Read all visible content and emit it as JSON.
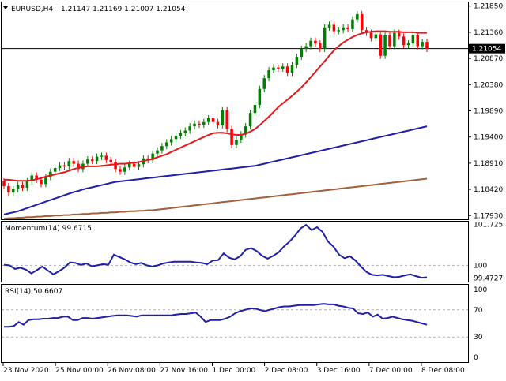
{
  "chart_data": [
    {
      "type": "candlestick",
      "panel": "main",
      "header": {
        "symbol": "EURUSD,H4",
        "ohlc_text": "1.21147 1.21169 1.21007 1.21054"
      },
      "y_ticks": [
        "1.21850",
        "1.21360",
        "1.20870",
        "1.20380",
        "1.19890",
        "1.19400",
        "1.18910",
        "1.18420",
        "1.17930"
      ],
      "y_tick_values": [
        1.2185,
        1.2136,
        1.2087,
        1.2038,
        1.1989,
        1.194,
        1.1891,
        1.1842,
        1.1793
      ],
      "ylim": [
        1.1786,
        1.2192
      ],
      "current_price": "1.21054",
      "current_price_value": 1.21054,
      "bars_open_close": [
        [
          1.1857,
          1.1848
        ],
        [
          1.1848,
          1.1836
        ],
        [
          1.1836,
          1.1842
        ],
        [
          1.1842,
          1.185
        ],
        [
          1.185,
          1.1845
        ],
        [
          1.1845,
          1.1857
        ],
        [
          1.1857,
          1.1868
        ],
        [
          1.1868,
          1.186
        ],
        [
          1.186,
          1.1852
        ],
        [
          1.1852,
          1.1865
        ],
        [
          1.1865,
          1.1875
        ],
        [
          1.1875,
          1.1882
        ],
        [
          1.1882,
          1.1887
        ],
        [
          1.1887,
          1.1885
        ],
        [
          1.1885,
          1.1895
        ],
        [
          1.1895,
          1.189
        ],
        [
          1.189,
          1.188
        ],
        [
          1.188,
          1.189
        ],
        [
          1.189,
          1.1898
        ],
        [
          1.1898,
          1.1895
        ],
        [
          1.1895,
          1.1903
        ],
        [
          1.1903,
          1.1905
        ],
        [
          1.1905,
          1.1897
        ],
        [
          1.1897,
          1.1893
        ],
        [
          1.1893,
          1.188
        ],
        [
          1.188,
          1.1875
        ],
        [
          1.1875,
          1.1883
        ],
        [
          1.1883,
          1.189
        ],
        [
          1.189,
          1.1884
        ],
        [
          1.1884,
          1.1889
        ],
        [
          1.1889,
          1.19
        ],
        [
          1.19,
          1.1897
        ],
        [
          1.1897,
          1.1909
        ],
        [
          1.1909,
          1.1915
        ],
        [
          1.1915,
          1.1923
        ],
        [
          1.1923,
          1.193
        ],
        [
          1.193,
          1.1936
        ],
        [
          1.1936,
          1.1942
        ],
        [
          1.1942,
          1.1947
        ],
        [
          1.1947,
          1.1952
        ],
        [
          1.1952,
          1.196
        ],
        [
          1.196,
          1.1965
        ],
        [
          1.1965,
          1.1963
        ],
        [
          1.1963,
          1.1968
        ],
        [
          1.1968,
          1.1975
        ],
        [
          1.1975,
          1.1968
        ],
        [
          1.1968,
          1.1962
        ],
        [
          1.1962,
          1.199
        ],
        [
          1.199,
          1.1955
        ],
        [
          1.1955,
          1.1925
        ],
        [
          1.1925,
          1.1935
        ],
        [
          1.1935,
          1.1945
        ],
        [
          1.1945,
          1.196
        ],
        [
          1.196,
          1.1985
        ],
        [
          1.1985,
          1.2
        ],
        [
          1.2,
          1.203
        ],
        [
          1.203,
          1.205
        ],
        [
          1.205,
          1.2065
        ],
        [
          1.2065,
          1.207
        ],
        [
          1.207,
          1.2068
        ],
        [
          1.2068,
          1.2072
        ],
        [
          1.2072,
          1.206
        ],
        [
          1.206,
          1.2075
        ],
        [
          1.2075,
          1.209
        ],
        [
          1.209,
          1.2105
        ],
        [
          1.2105,
          1.211
        ],
        [
          1.211,
          1.212
        ],
        [
          1.212,
          1.2115
        ],
        [
          1.2115,
          1.2105
        ],
        [
          1.2105,
          1.2145
        ],
        [
          1.2145,
          1.215
        ],
        [
          1.215,
          1.2138
        ],
        [
          1.2138,
          1.214
        ],
        [
          1.214,
          1.2145
        ],
        [
          1.2145,
          1.2142
        ],
        [
          1.2142,
          1.216
        ],
        [
          1.216,
          1.217
        ],
        [
          1.217,
          1.214
        ],
        [
          1.214,
          1.2135
        ],
        [
          1.2135,
          1.2125
        ],
        [
          1.2125,
          1.2132
        ],
        [
          1.2132,
          1.2092
        ],
        [
          1.2092,
          1.213
        ],
        [
          1.213,
          1.211
        ],
        [
          1.211,
          1.2135
        ],
        [
          1.2135,
          1.2128
        ],
        [
          1.2128,
          1.2112
        ],
        [
          1.2112,
          1.2115
        ],
        [
          1.2115,
          1.213
        ],
        [
          1.213,
          1.211
        ],
        [
          1.211,
          1.2118
        ],
        [
          1.2118,
          1.2105
        ]
      ],
      "sma_red": [
        1.186,
        1.186,
        1.1859,
        1.1858,
        1.1858,
        1.1858,
        1.1859,
        1.1861,
        1.1863,
        1.1866,
        1.1868,
        1.187,
        1.1872,
        1.1874,
        1.1877,
        1.188,
        1.1882,
        1.1884,
        1.1885,
        1.1885,
        1.1885,
        1.1886,
        1.1887,
        1.1888,
        1.1889,
        1.189,
        1.189,
        1.1891,
        1.1892,
        1.1893,
        1.1895,
        1.1897,
        1.1899,
        1.1902,
        1.1905,
        1.1908,
        1.1912,
        1.1916,
        1.192,
        1.1924,
        1.1928,
        1.1932,
        1.1936,
        1.194,
        1.1944,
        1.1947,
        1.1948,
        1.1948,
        1.1947,
        1.1945,
        1.1944,
        1.1944,
        1.1946,
        1.195,
        1.1955,
        1.1962,
        1.197,
        1.1978,
        1.1987,
        1.1996,
        1.2003,
        1.201,
        1.2017,
        1.2025,
        1.2033,
        1.2042,
        1.2052,
        1.2062,
        1.2072,
        1.2082,
        1.2092,
        1.2102,
        1.211,
        1.2117,
        1.2122,
        1.2127,
        1.2131,
        1.2134,
        1.2136,
        1.2137,
        1.2138,
        1.2138,
        1.2138,
        1.2137,
        1.2137,
        1.2137,
        1.2136,
        1.2136,
        1.2136,
        1.2135,
        1.2135,
        1.2135
      ],
      "sma_blue": [
        1.1795,
        1.1797,
        1.1799,
        1.1801,
        1.1804,
        1.1807,
        1.181,
        1.1813,
        1.1816,
        1.1819,
        1.1822,
        1.1825,
        1.1828,
        1.1831,
        1.1834,
        1.1837,
        1.1839,
        1.1842,
        1.1844,
        1.1846,
        1.1848,
        1.185,
        1.1852,
        1.1854,
        1.1856,
        1.1857,
        1.1858,
        1.1859,
        1.186,
        1.1861,
        1.1862,
        1.1863,
        1.1864,
        1.1865,
        1.1866,
        1.1867,
        1.1868,
        1.1869,
        1.187,
        1.1871,
        1.1872,
        1.1873,
        1.1874,
        1.1875,
        1.1876,
        1.1877,
        1.1878,
        1.1879,
        1.188,
        1.1881,
        1.1882,
        1.1883,
        1.1884,
        1.1885,
        1.1886,
        1.1888,
        1.189,
        1.1892,
        1.1894,
        1.1896,
        1.1898,
        1.19,
        1.1902,
        1.1904,
        1.1906,
        1.1908,
        1.191,
        1.1912,
        1.1914,
        1.1916,
        1.1918,
        1.192,
        1.1922,
        1.1924,
        1.1926,
        1.1928,
        1.193,
        1.1932,
        1.1934,
        1.1936,
        1.1938,
        1.194,
        1.1942,
        1.1944,
        1.1946,
        1.1948,
        1.195,
        1.1952,
        1.1954,
        1.1956,
        1.1958,
        1.196
      ],
      "sma_brown": [
        1.1787,
        1.1788,
        1.1788,
        1.1789,
        1.1789,
        1.179,
        1.179,
        1.1791,
        1.1791,
        1.1792,
        1.1792,
        1.1793,
        1.1793,
        1.1794,
        1.1794,
        1.1795,
        1.1795,
        1.1796,
        1.1796,
        1.1797,
        1.1797,
        1.1798,
        1.1798,
        1.1799,
        1.1799,
        1.18,
        1.18,
        1.1801,
        1.1801,
        1.1802,
        1.1802,
        1.1803,
        1.1803,
        1.1804,
        1.1805,
        1.1806,
        1.1807,
        1.1808,
        1.1809,
        1.181,
        1.1811,
        1.1812,
        1.1813,
        1.1814,
        1.1815,
        1.1816,
        1.1817,
        1.1818,
        1.1819,
        1.182,
        1.1821,
        1.1822,
        1.1823,
        1.1824,
        1.1825,
        1.1826,
        1.1827,
        1.1828,
        1.1829,
        1.183,
        1.1831,
        1.1832,
        1.1833,
        1.1834,
        1.1835,
        1.1836,
        1.1837,
        1.1838,
        1.1839,
        1.184,
        1.1841,
        1.1842,
        1.1843,
        1.1844,
        1.1845,
        1.1846,
        1.1847,
        1.1848,
        1.1849,
        1.185,
        1.1851,
        1.1852,
        1.1853,
        1.1854,
        1.1855,
        1.1856,
        1.1857,
        1.1858,
        1.1859,
        1.186,
        1.1861,
        1.1862
      ],
      "colors": {
        "bull": "#008000",
        "bear": "#ff0000",
        "sma_red": "#e31a1c",
        "sma_blue": "#1f1fa8",
        "sma_brown": "#a0603a",
        "price_line": "#000000"
      }
    },
    {
      "type": "line",
      "panel": "momentum",
      "label": "Momentum(14) 99.6715",
      "y_ticks": [
        "101.725",
        "100",
        "99.4727"
      ],
      "y_tick_values": [
        101.725,
        100.0,
        99.4727
      ],
      "ylim": [
        99.35,
        101.8
      ],
      "level": 100,
      "values": [
        100.02,
        100.0,
        99.85,
        99.9,
        99.82,
        99.66,
        99.8,
        99.95,
        99.78,
        99.62,
        99.75,
        99.9,
        100.12,
        100.1,
        100.02,
        100.08,
        99.96,
        100.0,
        100.05,
        100.02,
        100.45,
        100.35,
        100.25,
        100.12,
        100.05,
        100.1,
        100.0,
        99.95,
        100.0,
        100.08,
        100.12,
        100.15,
        100.15,
        100.15,
        100.15,
        100.12,
        100.1,
        100.05,
        100.2,
        100.22,
        100.5,
        100.32,
        100.25,
        100.38,
        100.65,
        100.72,
        100.6,
        100.4,
        100.28,
        100.4,
        100.55,
        100.8,
        101.0,
        101.25,
        101.55,
        101.7,
        101.48,
        101.6,
        101.4,
        101.0,
        100.78,
        100.45,
        100.3,
        100.38,
        100.2,
        99.95,
        99.72,
        99.6,
        99.58,
        99.6,
        99.55,
        99.5,
        99.52,
        99.58,
        99.62,
        99.55,
        99.48,
        99.5
      ],
      "colors": {
        "line": "#1f1fa8",
        "level": "#b0b0b0"
      }
    },
    {
      "type": "line",
      "panel": "rsi",
      "label": "RSI(14) 50.6607",
      "y_ticks": [
        "100",
        "70",
        "30",
        "0"
      ],
      "y_tick_values": [
        100,
        70,
        30,
        0
      ],
      "ylim": [
        0,
        100
      ],
      "levels": [
        70,
        30
      ],
      "values": [
        45,
        45,
        46,
        52,
        48,
        55,
        56,
        56,
        57,
        57,
        58,
        58,
        60,
        60,
        55,
        55,
        58,
        58,
        57,
        58,
        59,
        60,
        61,
        62,
        62,
        62,
        61,
        60,
        62,
        62,
        62,
        62,
        62,
        62,
        62,
        63,
        64,
        64,
        65,
        66,
        60,
        52,
        55,
        55,
        55,
        57,
        60,
        65,
        68,
        70,
        72,
        72,
        70,
        68,
        70,
        72,
        74,
        75,
        75,
        76,
        77,
        77,
        77,
        77,
        78,
        79,
        78,
        78,
        76,
        75,
        73,
        72,
        65,
        64,
        66,
        60,
        63,
        57,
        58,
        60,
        58,
        56,
        55,
        54,
        52,
        50,
        48
      ],
      "colors": {
        "line": "#1f1fa8",
        "level": "#b0b0b0"
      }
    },
    {
      "type": "time_axis",
      "labels": [
        "23 Nov 2020",
        "25 Nov 00:00",
        "26 Nov 08:00",
        "27 Nov 16:00",
        "1 Dec 00:00",
        "2 Dec 08:00",
        "3 Dec 16:00",
        "7 Dec 00:00",
        "8 Dec 08:00"
      ]
    }
  ]
}
